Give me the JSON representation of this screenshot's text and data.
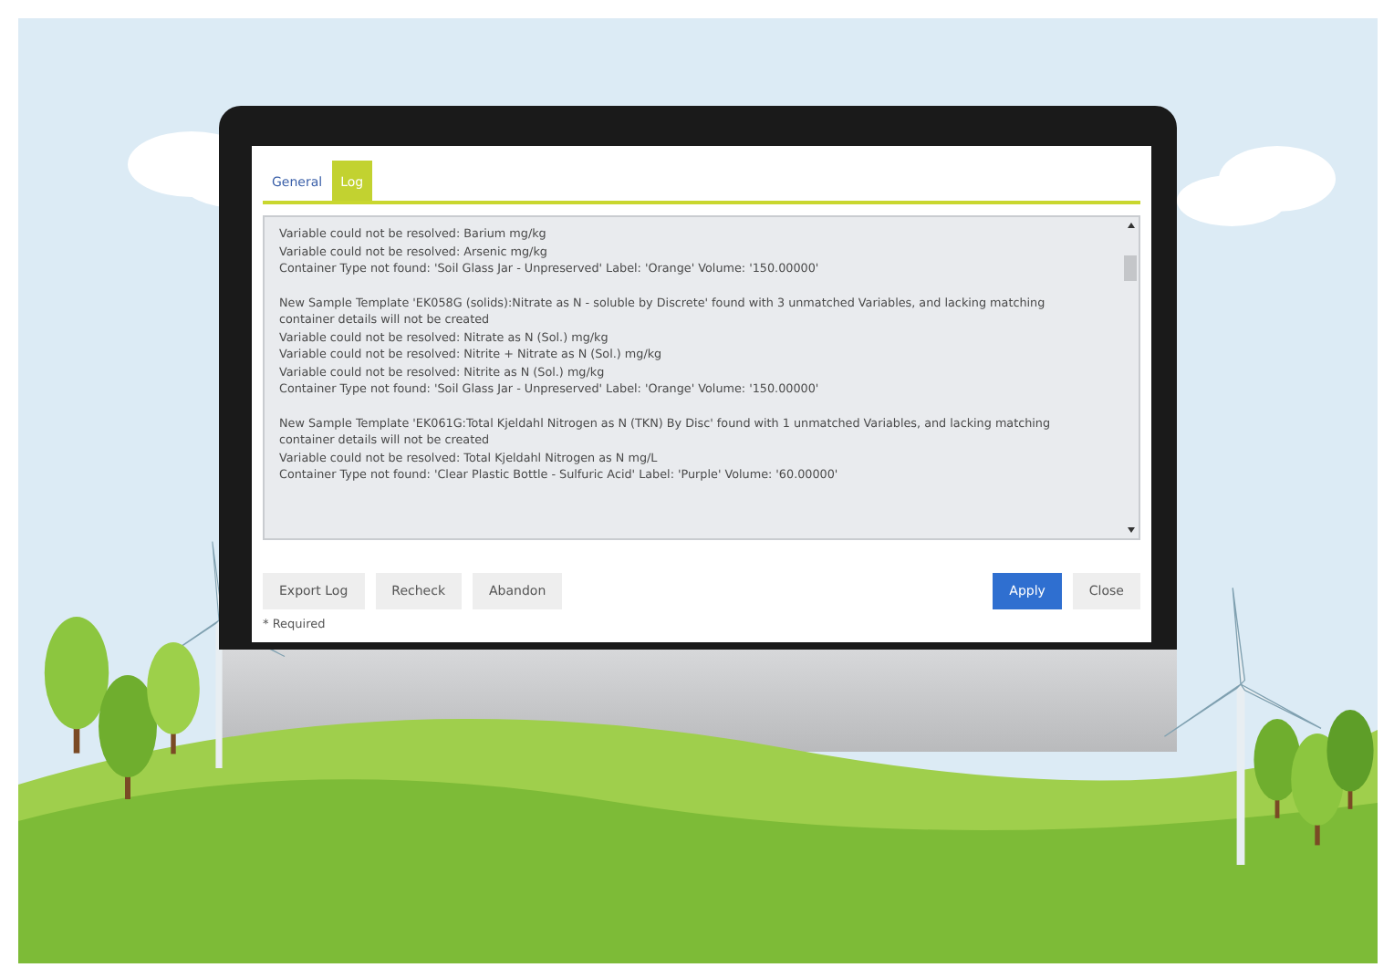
{
  "tabs": [
    {
      "label": "General",
      "selected": false
    },
    {
      "label": "Log",
      "selected": true
    }
  ],
  "log": {
    "blocks": [
      [
        "Variable could not be resolved: Barium mg/kg",
        "Variable could not be resolved: Arsenic mg/kg",
        "Container Type not found: 'Soil Glass Jar - Unpreserved' Label: 'Orange' Volume: '150.00000'"
      ],
      [
        "New Sample Template 'EK058G (solids):Nitrate as N - soluble by Discrete' found with 3 unmatched Variables, and lacking matching container details will not be created",
        "Variable could not be resolved: Nitrate as N (Sol.) mg/kg",
        "Variable could not be resolved: Nitrite + Nitrate as N (Sol.) mg/kg",
        "Variable could not be resolved: Nitrite as N (Sol.) mg/kg",
        "Container Type not found: 'Soil Glass Jar - Unpreserved' Label: 'Orange' Volume: '150.00000'"
      ],
      [
        "New Sample Template 'EK061G:Total Kjeldahl Nitrogen as N (TKN) By Disc' found with 1 unmatched Variables, and lacking matching container details will not be created",
        "Variable could not be resolved: Total Kjeldahl Nitrogen as N mg/L",
        "Container Type not found: 'Clear Plastic Bottle - Sulfuric Acid' Label: 'Purple' Volume: '60.00000'"
      ]
    ]
  },
  "buttons_left": [
    "Export Log",
    "Recheck",
    "Abandon"
  ],
  "buttons_right": [
    {
      "label": "Apply",
      "kind": "primary"
    },
    {
      "label": "Close",
      "kind": "default"
    }
  ],
  "footnote": "* Required"
}
